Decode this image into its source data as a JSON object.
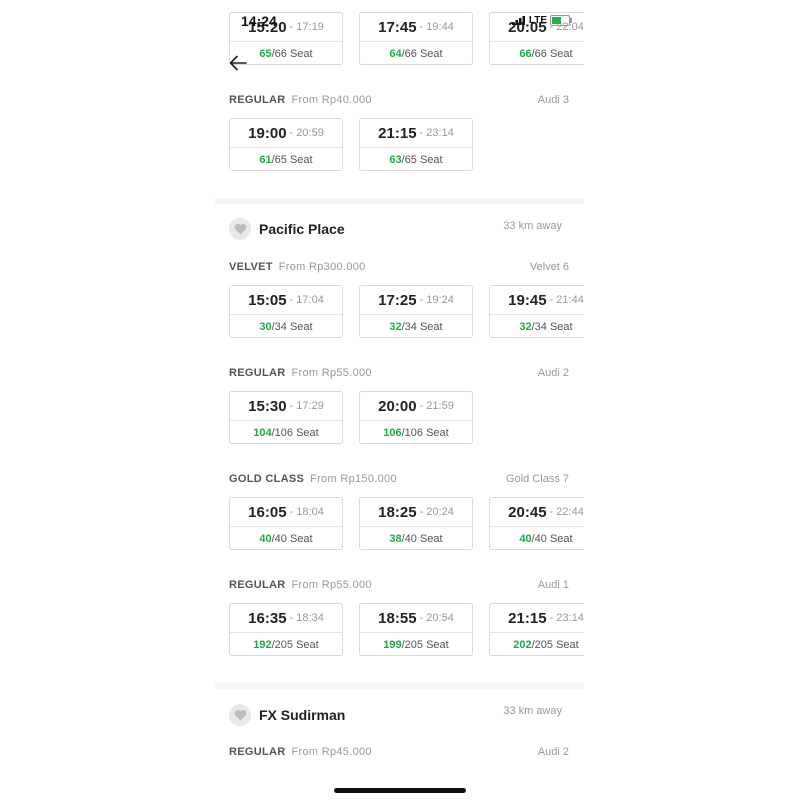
{
  "status": {
    "time": "14:24",
    "network": "LTE"
  },
  "cinemas": [
    {
      "name": "",
      "distance": "",
      "rows": [
        {
          "type": "",
          "from": "",
          "audi": "",
          "slots": [
            {
              "start": "15:20",
              "end": "17:19",
              "available": "65",
              "total": "/66 Seat"
            },
            {
              "start": "17:45",
              "end": "19:44",
              "available": "64",
              "total": "/66 Seat"
            },
            {
              "start": "20:05",
              "end": "22:04",
              "available": "66",
              "total": "/66 Seat"
            }
          ]
        },
        {
          "type": "REGULAR",
          "from": "From Rp40.000",
          "audi": "Audi 3",
          "slots": [
            {
              "start": "19:00",
              "end": "20:59",
              "available": "61",
              "total": "/65 Seat"
            },
            {
              "start": "21:15",
              "end": "23:14",
              "available": "63",
              "total": "/65 Seat"
            }
          ]
        }
      ]
    },
    {
      "name": "Pacific Place",
      "distance": "33 km away",
      "rows": [
        {
          "type": "VELVET",
          "from": "From Rp300.000",
          "audi": "Velvet 6",
          "slots": [
            {
              "start": "15:05",
              "end": "17:04",
              "available": "30",
              "total": "/34 Seat"
            },
            {
              "start": "17:25",
              "end": "19:24",
              "available": "32",
              "total": "/34 Seat"
            },
            {
              "start": "19:45",
              "end": "21:44",
              "available": "32",
              "total": "/34 Seat"
            }
          ]
        },
        {
          "type": "REGULAR",
          "from": "From Rp55.000",
          "audi": "Audi 2",
          "slots": [
            {
              "start": "15:30",
              "end": "17:29",
              "available": "104",
              "total": "/106 Seat"
            },
            {
              "start": "20:00",
              "end": "21:59",
              "available": "106",
              "total": "/106 Seat"
            }
          ]
        },
        {
          "type": "GOLD CLASS",
          "from": "From Rp150.000",
          "audi": "Gold Class 7",
          "slots": [
            {
              "start": "16:05",
              "end": "18:04",
              "available": "40",
              "total": "/40 Seat"
            },
            {
              "start": "18:25",
              "end": "20:24",
              "available": "38",
              "total": "/40 Seat"
            },
            {
              "start": "20:45",
              "end": "22:44",
              "available": "40",
              "total": "/40 Seat"
            }
          ]
        },
        {
          "type": "REGULAR",
          "from": "From Rp55.000",
          "audi": "Audi 1",
          "slots": [
            {
              "start": "16:35",
              "end": "18:34",
              "available": "192",
              "total": "/205 Seat"
            },
            {
              "start": "18:55",
              "end": "20:54",
              "available": "199",
              "total": "/205 Seat"
            },
            {
              "start": "21:15",
              "end": "23:14",
              "available": "202",
              "total": "/205 Seat"
            }
          ]
        }
      ]
    },
    {
      "name": "FX Sudirman",
      "distance": "33 km away",
      "rows": [
        {
          "type": "REGULAR",
          "from": "From Rp45.000",
          "audi": "Audi 2",
          "slots": []
        }
      ]
    }
  ]
}
